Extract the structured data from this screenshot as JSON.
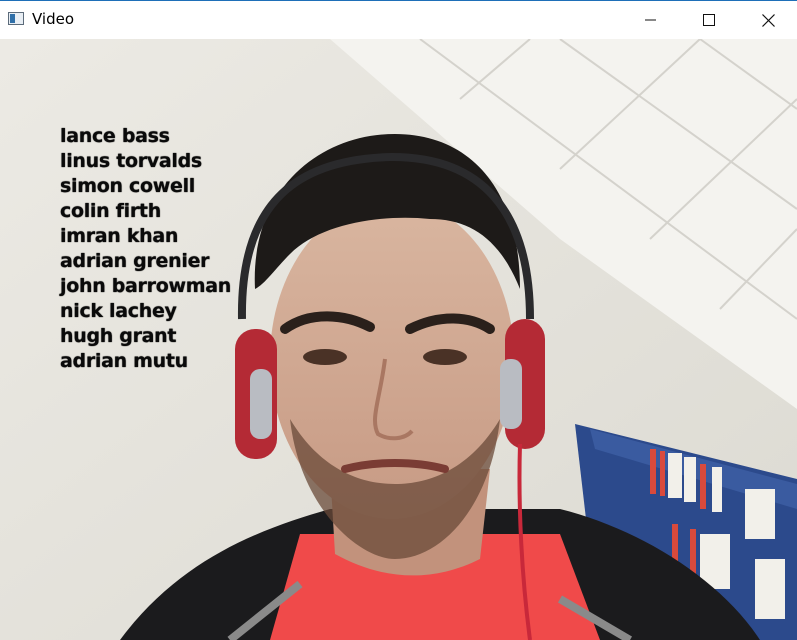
{
  "window": {
    "title": "Video",
    "icon": "app-window-icon",
    "controls": [
      "minimize-icon",
      "maximize-icon",
      "close-icon"
    ]
  },
  "video": {
    "recognized_names": [
      "lance bass",
      "linus torvalds",
      "simon cowell",
      "colin firth",
      "imran khan",
      "adrian grenier",
      "john barrowman",
      "nick lachey",
      "hugh grant",
      "adrian mutu"
    ]
  },
  "colors": {
    "titlebar": "#ffffff",
    "text_overlay": "#0a0a0a",
    "shirt": "#f04a4a",
    "bookshelf": "#2c4a8c"
  }
}
